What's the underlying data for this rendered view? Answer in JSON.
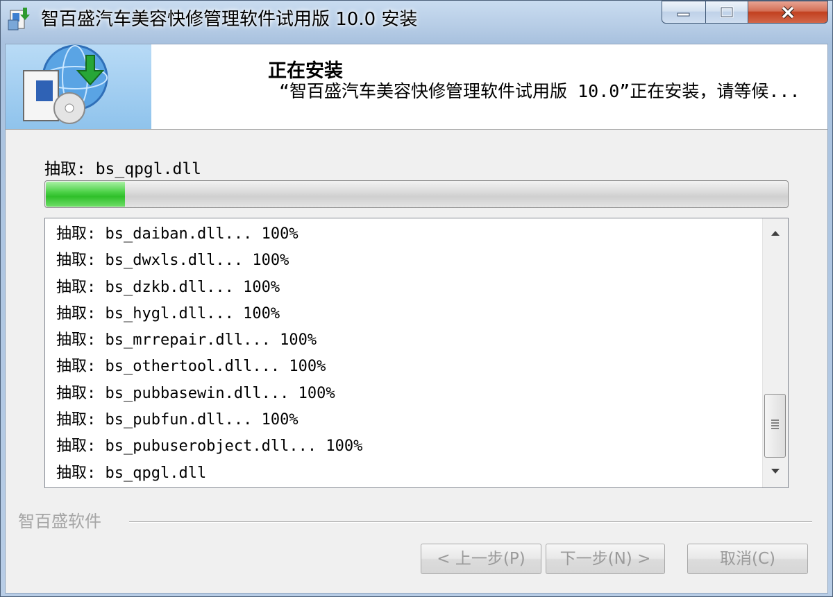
{
  "window": {
    "title": "智百盛汽车美容快修管理软件试用版 10.0 安装"
  },
  "header": {
    "title": "正在安装",
    "description": "“智百盛汽车美容快修管理软件试用版 10.0”正在安装，请等候..."
  },
  "progress": {
    "label": "抽取: bs_qpgl.dll",
    "fraction": 0.107,
    "fill_color": "#3cc236"
  },
  "log": {
    "lines": [
      "抽取: bs_daiban.dll... 100%",
      "抽取: bs_dwxls.dll... 100%",
      "抽取: bs_dzkb.dll... 100%",
      "抽取: bs_hygl.dll... 100%",
      "抽取: bs_mrrepair.dll... 100%",
      "抽取: bs_othertool.dll... 100%",
      "抽取: bs_pubbasewin.dll... 100%",
      "抽取: bs_pubfun.dll... 100%",
      "抽取: bs_pubuserobject.dll... 100%",
      "抽取: bs_qpgl.dll"
    ]
  },
  "footer": {
    "brand": "智百盛软件",
    "back_label": "< 上一步(P)",
    "next_label": "下一步(N) >",
    "cancel_label": "取消(C)"
  },
  "icons": {
    "app": "installer-icon",
    "minimize": "minimize-icon",
    "maximize": "maximize-icon",
    "close": "close-icon",
    "scroll_up": "scroll-up-arrow-icon",
    "scroll_down": "scroll-down-arrow-icon"
  }
}
